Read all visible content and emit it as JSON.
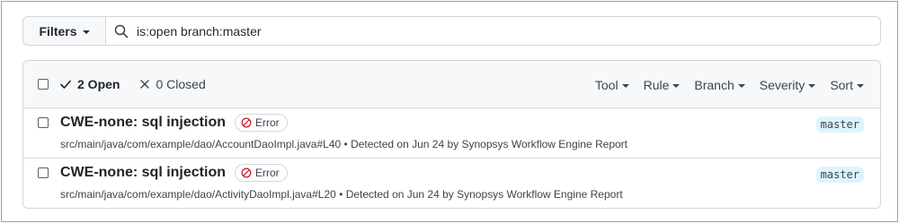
{
  "filter_bar": {
    "filters_label": "Filters",
    "query": "is:open branch:master"
  },
  "header": {
    "open_label": "2 Open",
    "closed_label": "0 Closed",
    "sort_menus": [
      "Tool",
      "Rule",
      "Branch",
      "Severity",
      "Sort"
    ]
  },
  "alerts": [
    {
      "title": "CWE-none: sql injection",
      "label": "Error",
      "path": "src/main/java/com/example/dao/AccountDaoImpl.java#L40",
      "detail": "Detected on Jun 24 by Synopsys Workflow Engine Report",
      "branch": "master"
    },
    {
      "title": "CWE-none: sql injection",
      "label": "Error",
      "path": "src/main/java/com/example/dao/ActivityDaoImpl.java#L20",
      "detail": "Detected on Jun 24 by Synopsys Workflow Engine Report",
      "branch": "master"
    }
  ],
  "colors": {
    "error_icon": "#cf222e",
    "branch_bg": "#ddf4ff",
    "header_bg": "#f6f8fa",
    "border": "#d0d7de"
  }
}
